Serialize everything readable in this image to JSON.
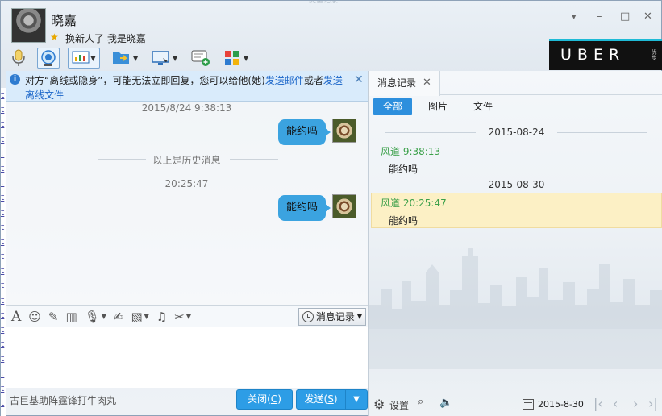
{
  "window": {
    "top_tab_hint": "麦留记录",
    "contact_name": "晓嘉",
    "signature": "换新人了  我是晓嘉",
    "controls": {
      "menu": "▾",
      "minimize": "–",
      "maximize": "□",
      "close": "✕"
    }
  },
  "toolbar": {
    "icons": [
      "microphone-icon",
      "video-camera-icon",
      "screen-share-icon",
      "file-transfer-icon",
      "remote-desktop-icon",
      "group-chat-icon",
      "apps-icon"
    ]
  },
  "ad": {
    "brand": "UBER",
    "tag": "优步"
  },
  "notice": {
    "text_before": "对方“离线或隐身”，可能无法立即回复，您可以给他(她)",
    "link1": "发送邮件",
    "text_middle": "或者",
    "link2": "发送离线文件"
  },
  "chat": {
    "messages": [
      {
        "timestamp": "2015/8/24 9:38:13",
        "text": "能约吗"
      },
      {
        "divider": "以上是历史消息",
        "timestamp": "20:25:47",
        "text": "能约吗"
      }
    ]
  },
  "input_toolbar": {
    "history_button": "消息记录"
  },
  "footer": {
    "ad_text": "古巨基助阵霆锋打牛肉丸",
    "close_label": "关闭(",
    "close_key": "C",
    "send_label": "发送(",
    "send_key": "S",
    "paren_close": ")"
  },
  "history_panel": {
    "tab_label": "消息记录",
    "filters": [
      "全部",
      "图片",
      "文件"
    ],
    "groups": [
      {
        "date": "2015-08-24",
        "sender_time": "风道 9:38:13",
        "text": "能约吗"
      },
      {
        "date": "2015-08-30",
        "sender_time": "风道 20:25:47",
        "text": "能约吗"
      }
    ],
    "settings_label": "设置",
    "date_value": "2015-8-30"
  },
  "colors": {
    "accent": "#2d8fdd",
    "bubble": "#3ba3e0",
    "sender": "#3ba04a",
    "highlight": "#fcf0c5"
  }
}
